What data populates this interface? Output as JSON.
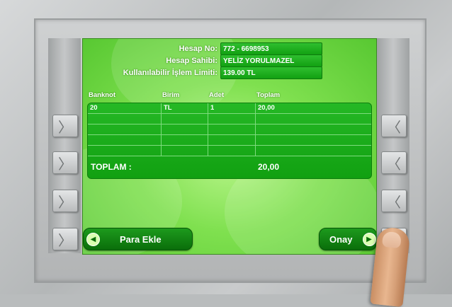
{
  "account": {
    "account_no_label": "Hesap No:",
    "account_no_value": "772 - 6698953",
    "holder_label": "Hesap Sahibi:",
    "holder_value": "YELİZ YORULMAZEL",
    "limit_label": "Kullanılabilir İşlem Limiti:",
    "limit_value": "139.00   TL"
  },
  "table": {
    "headers": [
      "Banknot",
      "Birim",
      "Adet",
      "Toplam"
    ],
    "rows": [
      [
        "20",
        "TL",
        "1",
        "20,00"
      ]
    ],
    "total_label": "TOPLAM :",
    "total_value": "20,00"
  },
  "buttons": {
    "add_money": "Para Ekle",
    "confirm": "Onay"
  },
  "function_keys": {
    "left_glyph": "〉",
    "right_glyph": "〈"
  },
  "colors": {
    "screen_green": "#7fe04f",
    "panel_green": "#12a012",
    "button_green": "#0a6e0a"
  }
}
